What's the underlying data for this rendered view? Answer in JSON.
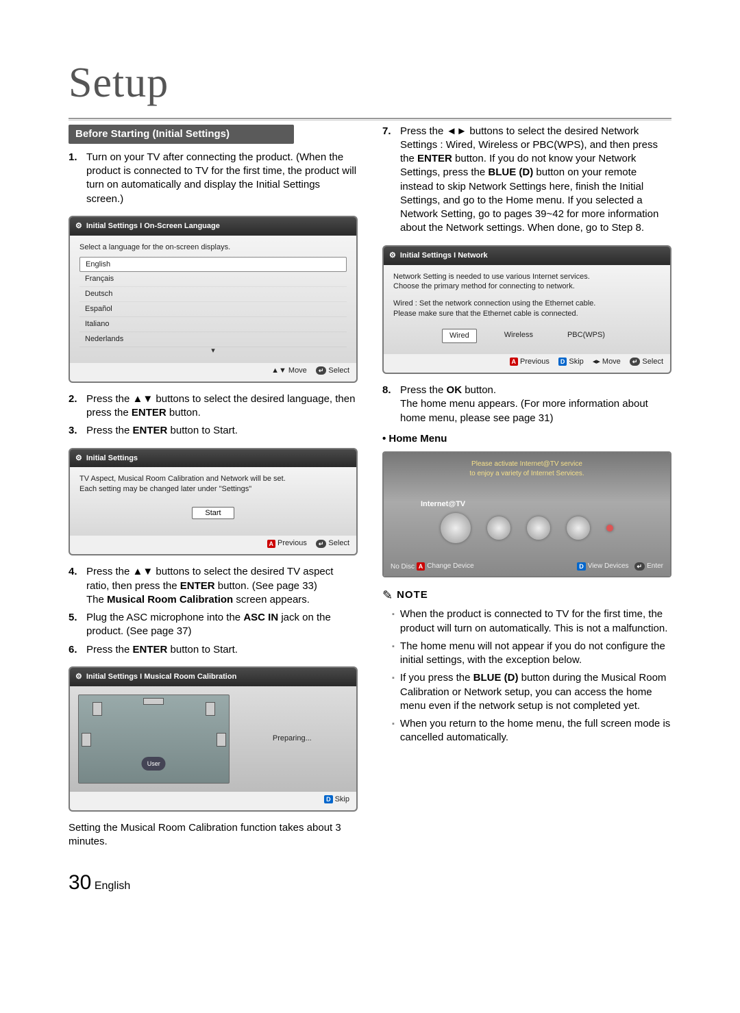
{
  "page": {
    "title": "Setup",
    "number": "30",
    "lang": "English"
  },
  "section": {
    "heading": "Before Starting (Initial Settings)"
  },
  "steps_left": {
    "s1": {
      "n": "1.",
      "t": "Turn on your TV after connecting the product. (When the product is connected to TV for the first time, the product  will turn on automatically and display the Initial Settings screen.)"
    },
    "s2": {
      "n": "2.",
      "pre": "Press the ",
      "arrows": "▲▼",
      "mid": " buttons to select the desired language, then press the ",
      "b": "ENTER",
      "post": " button."
    },
    "s3": {
      "n": "3.",
      "pre": "Press the ",
      "b": "ENTER",
      "post": " button to Start."
    },
    "s4": {
      "n": "4.",
      "pre": "Press the ",
      "arrows": "▲▼",
      "mid": " buttons to select the desired TV aspect ratio, then press the ",
      "b": "ENTER",
      "post1": " button. (See page 33)",
      "line2a": "The ",
      "line2b": "Musical Room Calibration",
      "line2c": " screen appears."
    },
    "s5": {
      "n": "5.",
      "pre": "Plug the ASC microphone into the ",
      "b": "ASC IN",
      "post": " jack on the product. (See page 37)"
    },
    "s6": {
      "n": "6.",
      "pre": "Press the ",
      "b": "ENTER",
      "post": " button to Start."
    },
    "calib_note": "Setting the Musical Room Calibration function takes about 3 minutes."
  },
  "steps_right": {
    "s7": {
      "n": "7.",
      "pre": "Press the ",
      "arrows": "◄►",
      "mid": " buttons to select the desired Network Settings : Wired, Wireless or PBC(WPS), and then press the ",
      "b1": "ENTER",
      "mid2": " button. If you do not know your Network Settings, press the ",
      "b2": "BLUE (D)",
      "post": " button on your remote instead to skip Network Settings here, finish the Initial Settings, and go to the Home menu. If you selected a Network Setting, go to pages 39~42 for more information about the Network settings. When done, go to Step 8."
    },
    "s8": {
      "n": "8.",
      "pre": "Press the ",
      "b": "OK",
      "post": " button.",
      "line2": "The home menu appears. (For more information about home menu, please see page 31)"
    },
    "home_label": "• Home Menu"
  },
  "note": {
    "head": "NOTE",
    "n1": "When the product is connected to TV for the first time, the product will turn on automatically. This is not a malfunction.",
    "n2": "The home menu will not appear if you do not configure the initial settings, with the exception below.",
    "n3a": "If you press the ",
    "n3b": "BLUE (D)",
    "n3c": " button during the Musical Room Calibration or Network setup, you can access the home menu even if the network setup is not completed yet.",
    "n4": "When you return to the home menu, the full screen mode is cancelled automatically."
  },
  "panel_lang": {
    "title": "Initial Settings I On-Screen Language",
    "prompt": "Select a language for the on-screen displays.",
    "items": [
      "English",
      "Français",
      "Deutsch",
      "Español",
      "Italiano",
      "Nederlands"
    ],
    "move": "Move",
    "select": "Select"
  },
  "panel_start": {
    "title": "Initial Settings",
    "line1": "TV Aspect, Musical Room Calibration and Network will be set.",
    "line2": "Each setting may be changed later under \"Settings\"",
    "btn": "Start",
    "prev": "Previous",
    "select": "Select"
  },
  "panel_calib": {
    "title": "Initial Settings I Musical Room Calibration",
    "user": "User",
    "status": "Preparing...",
    "skip": "Skip"
  },
  "panel_net": {
    "title": "Initial Settings I Network",
    "line1": "Network Setting is needed to use various Internet services.",
    "line2": "Choose the primary method for connecting to network.",
    "line3": "Wired : Set the network connection using the Ethernet cable.",
    "line4": "Please make sure that the Ethernet cable is connected.",
    "opt1": "Wired",
    "opt2": "Wireless",
    "opt3": "PBC(WPS)",
    "prev": "Previous",
    "skip": "Skip",
    "move": "Move",
    "select": "Select"
  },
  "panel_home": {
    "banner1": "Please activate Internet@TV service",
    "banner2": "to enjoy a variety of Internet Services.",
    "label": "Internet@TV",
    "nodisc": "No Disc",
    "change": "Change Device",
    "view": "View Devices",
    "enter": "Enter"
  }
}
